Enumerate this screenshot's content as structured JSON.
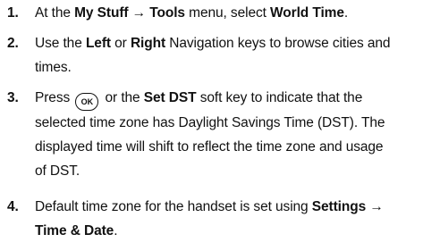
{
  "steps": [
    {
      "number": "1.",
      "parts": {
        "p1": "At the ",
        "b1": "My Stuff → Tools",
        "p2": " menu, select ",
        "b2": "World Time",
        "p3": "."
      }
    },
    {
      "number": "2.",
      "parts": {
        "p1": "Use the ",
        "b1": "Left",
        "p2": " or ",
        "b2": "Right",
        "p3": " Navigation keys to browse cities and",
        "p4": "times."
      }
    },
    {
      "number": "3.",
      "parts": {
        "p1": "Press ",
        "key": "OK",
        "p2": " or the ",
        "b1": "Set DST",
        "p3": " soft key to indicate that the",
        "line2": "selected time zone has Daylight Savings Time (DST). The",
        "line3": "displayed time will shift to reflect the time zone and usage",
        "line4": "of DST."
      }
    },
    {
      "number": "4.",
      "parts": {
        "p1": "Default time zone for the handset is set using ",
        "b1": "Settings →",
        "b2": "Time & Date",
        "p2": "."
      }
    }
  ]
}
